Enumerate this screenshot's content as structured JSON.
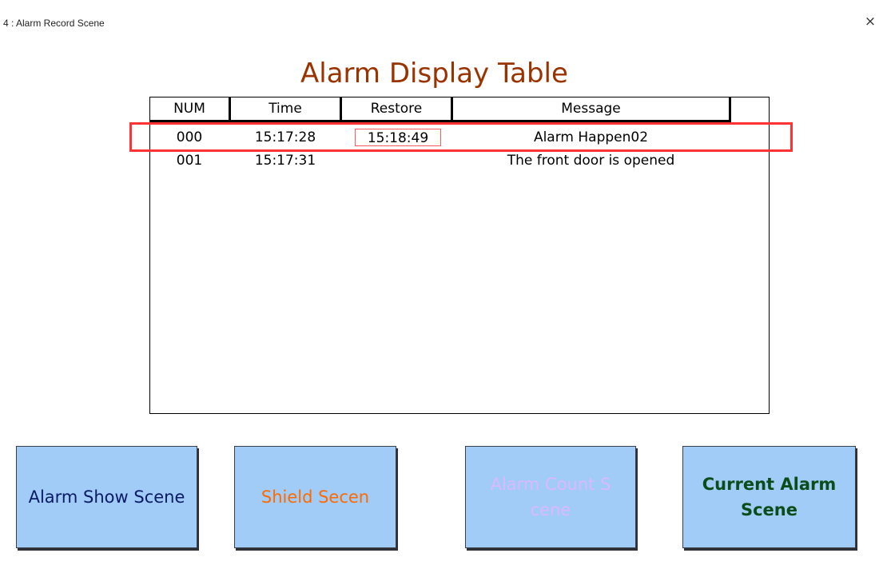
{
  "window": {
    "title": "4 : Alarm Record Scene",
    "close_glyph": "×"
  },
  "page_title": "Alarm Display Table",
  "table": {
    "columns": [
      "NUM",
      "Time",
      "Restore",
      "Message"
    ],
    "rows": [
      {
        "num": "000",
        "time": "15:17:28",
        "restore": "15:18:49",
        "message": "Alarm Happen02",
        "highlighted": true
      },
      {
        "num": "001",
        "time": "15:17:31",
        "restore": "",
        "message": "The front door is opened",
        "highlighted": false
      }
    ]
  },
  "buttons": {
    "alarm_show": {
      "label": "Alarm Show Scene",
      "color": "#0a1a66"
    },
    "shield": {
      "label": "Shield Secen",
      "color": "#ff6a00"
    },
    "alarm_count": {
      "label": "Alarm Count S\ncene",
      "color": "#dcb8ff"
    },
    "current_alarm": {
      "label": "Current Alarm\nScene",
      "color": "#0b4d1a"
    }
  },
  "colors": {
    "title_color": "#993300",
    "button_background": "#a0ccf7",
    "highlight_border": "#ff3333",
    "restore_box_border": "#ff5a5a"
  },
  "icons": {
    "close": "close-icon"
  }
}
